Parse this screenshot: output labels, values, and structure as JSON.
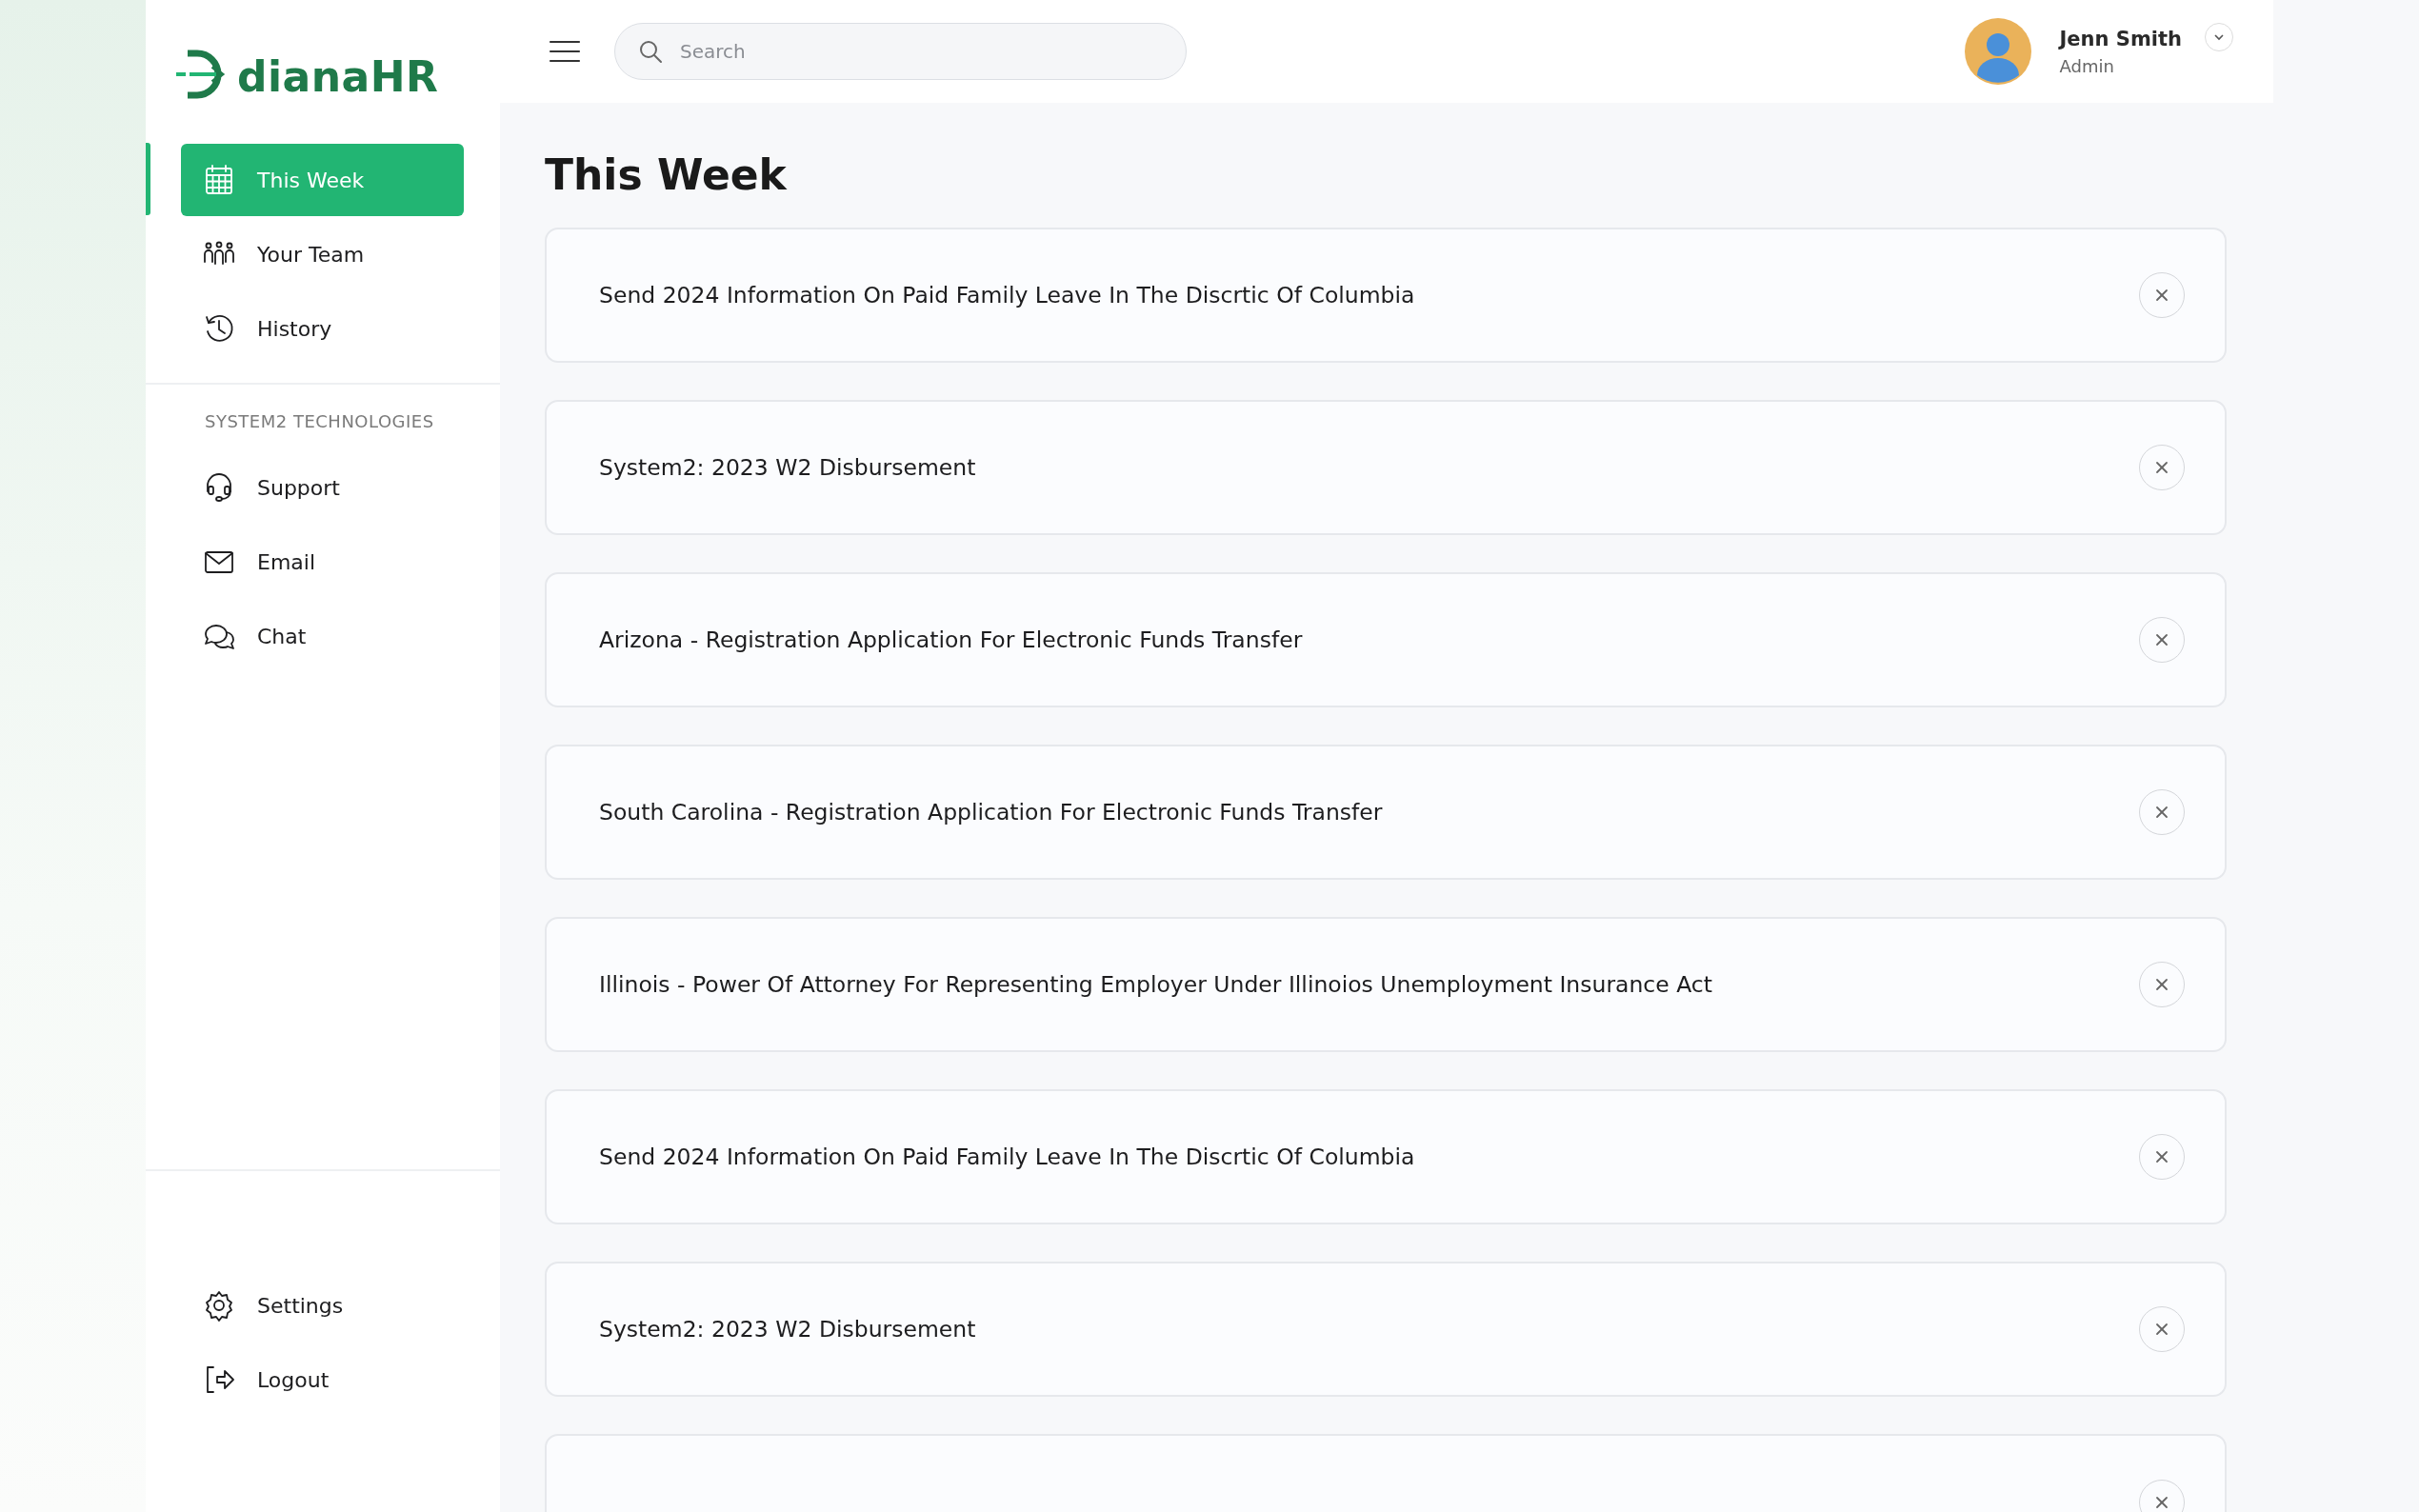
{
  "logo": {
    "text": "dianaHR"
  },
  "nav": [
    {
      "label": "This Week",
      "kind": "calendar",
      "selected": true
    },
    {
      "label": "Your Team",
      "kind": "team",
      "selected": false
    },
    {
      "label": "History",
      "kind": "history",
      "selected": false
    }
  ],
  "section": {
    "title": "SYSTEM2 TECHNOLOGIES",
    "items": [
      {
        "label": "Support",
        "kind": "headset"
      },
      {
        "label": "Email",
        "kind": "mail"
      },
      {
        "label": "Chat",
        "kind": "chat"
      }
    ]
  },
  "bottom_nav": [
    {
      "label": "Settings",
      "kind": "gear"
    },
    {
      "label": "Logout",
      "kind": "logout"
    }
  ],
  "search": {
    "placeholder": "Search"
  },
  "user": {
    "name": "Jenn Smith",
    "role": "Admin"
  },
  "page_title": "This Week",
  "tasks": [
    {
      "title": "Send 2024 Information On Paid Family Leave In The Discrtic Of Columbia"
    },
    {
      "title": "System2: 2023 W2 Disbursement"
    },
    {
      "title": "Arizona - Registration Application For Electronic Funds Transfer"
    },
    {
      "title": "South Carolina - Registration Application For Electronic Funds Transfer"
    },
    {
      "title": "Illinois - Power Of Attorney For Representing Employer Under Illinoios Unemployment Insurance Act"
    },
    {
      "title": "Send 2024 Information On Paid Family Leave In The Discrtic Of Columbia"
    },
    {
      "title": "System2: 2023 W2 Disbursement"
    }
  ],
  "more_tasks_below": true
}
